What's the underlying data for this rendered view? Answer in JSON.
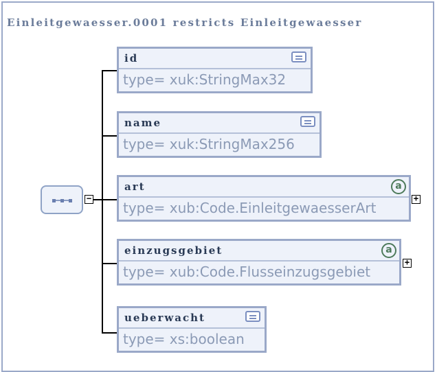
{
  "diagram": {
    "title": "Einleitgewaesser.0001 restricts Einleitgewaesser",
    "sequence_icon": "sequence-compositor-icon",
    "collapse_symbol": "−",
    "expand_symbol": "+",
    "elements": [
      {
        "name": "id",
        "type": "type= xuk:StringMax32",
        "icon": "documentation-icon"
      },
      {
        "name": "name",
        "type": "type= xuk:StringMax256",
        "icon": "documentation-icon"
      },
      {
        "name": "art",
        "type": "type= xub:Code.EinleitgewaesserArt",
        "icon": "attribute-icon",
        "icon_text": "a"
      },
      {
        "name": "einzugsgebiet",
        "type": "type= xub:Code.Flusseinzugsgebiet",
        "icon": "attribute-icon",
        "icon_text": "a"
      },
      {
        "name": "ueberwacht",
        "type": "type= xs:boolean",
        "icon": "documentation-icon"
      }
    ]
  }
}
